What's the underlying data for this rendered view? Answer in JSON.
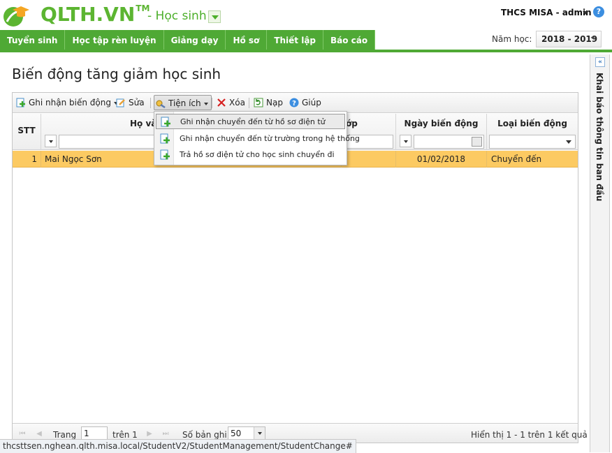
{
  "header": {
    "brand": "QLTH.VN",
    "brand_tm": "TM",
    "module": "- Học sinh",
    "user": "THCS MISA - admin",
    "help_glyph": "?"
  },
  "nav": {
    "items": [
      "Tuyển sinh",
      "Học tập rèn luyện",
      "Giảng dạy",
      "Hồ sơ",
      "Thiết lập",
      "Báo cáo"
    ],
    "year_label": "Năm học:",
    "year_value": "2018 - 2019"
  },
  "page": {
    "title": "Biến động tăng giảm học sinh"
  },
  "toolbar": {
    "record": "Ghi nhận biến động",
    "edit": "Sửa",
    "utility": "Tiện ích",
    "delete": "Xóa",
    "reload": "Nạp",
    "help": "Giúp"
  },
  "grid": {
    "columns": {
      "stt": "STT",
      "name": "Họ và tên",
      "class": "ớp",
      "date": "Ngày biến động",
      "type": "Loại biến động"
    },
    "rows": [
      {
        "stt": "1",
        "name": "Mai Ngọc Sơn",
        "date": "01/02/2018",
        "type": "Chuyển đến"
      }
    ]
  },
  "menu": {
    "items": [
      "Ghi nhận chuyển đến từ hồ sơ điện tử",
      "Ghi nhận chuyển đến từ trường trong hệ thống",
      "Trả hồ sơ điện tử cho học sinh chuyển đi"
    ]
  },
  "pager": {
    "page_label": "Trang",
    "page_value": "1",
    "of_label": "trên 1",
    "rows_label": "Số bản ghi",
    "rows_value": "50",
    "summary": "Hiển thị 1 - 1 trên 1 kết quả"
  },
  "side": {
    "label": "Khai báo thông tin ban đầu",
    "toggle": "«"
  },
  "status": {
    "url": "thcsttsen.nghean.qlth.misa.local/StudentV2/StudentManagement/StudentChange#"
  },
  "colors": {
    "brand_green": "#5cb531",
    "nav_green": "#4fa935",
    "row_selected": "#fcca62"
  }
}
